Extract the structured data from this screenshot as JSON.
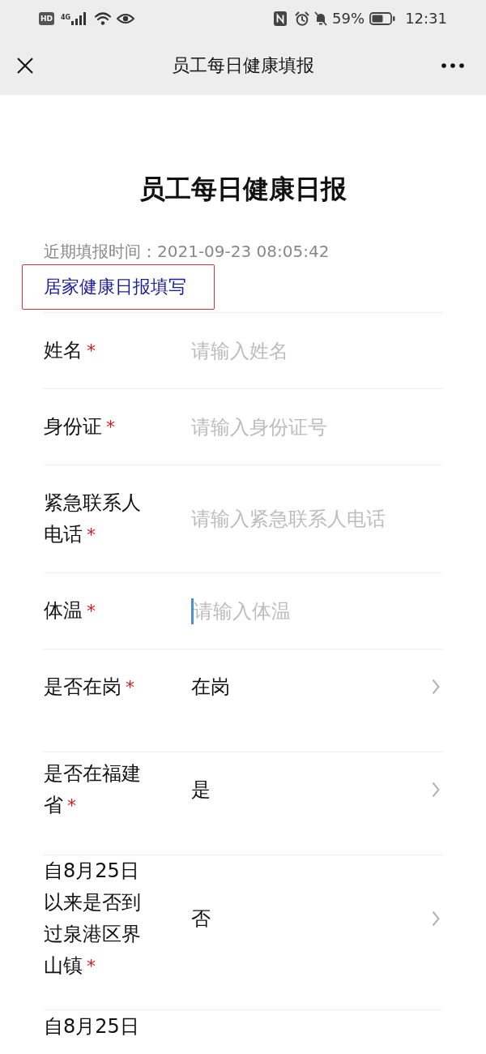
{
  "status_bar": {
    "hd_label": "HD",
    "network_type": "4G",
    "battery_percent": "59%",
    "time": "12:31"
  },
  "nav_bar": {
    "title": "员工每日健康填报"
  },
  "report": {
    "title": "员工每日健康日报",
    "last_filled": "近期填报时间：2021-09-23 08:05:42",
    "home_report_link": "居家健康日报填写"
  },
  "fields": [
    {
      "kind": "input",
      "label": "姓名",
      "required_mark": "*",
      "placeholder": "请输入姓名",
      "focused": false
    },
    {
      "kind": "input",
      "label": "身份证",
      "required_mark": "*",
      "placeholder": "请输入身份证号",
      "focused": false
    },
    {
      "kind": "input",
      "label": "紧急联系人电话",
      "required_mark": "*",
      "placeholder": "请输入紧急联系人电话",
      "focused": false
    },
    {
      "kind": "input",
      "label": "体温",
      "required_mark": "*",
      "placeholder": "请输入体温",
      "focused": true
    },
    {
      "kind": "select",
      "label": "是否在岗",
      "required_mark": "*",
      "value": "在岗"
    },
    {
      "kind": "select",
      "label": "是否在福建省",
      "required_mark": "*",
      "value": "是"
    },
    {
      "kind": "select",
      "label": "自8月25日以来是否到过泉港区界山镇",
      "required_mark": "*",
      "value": "否"
    },
    {
      "label": "自8月25日"
    }
  ]
}
